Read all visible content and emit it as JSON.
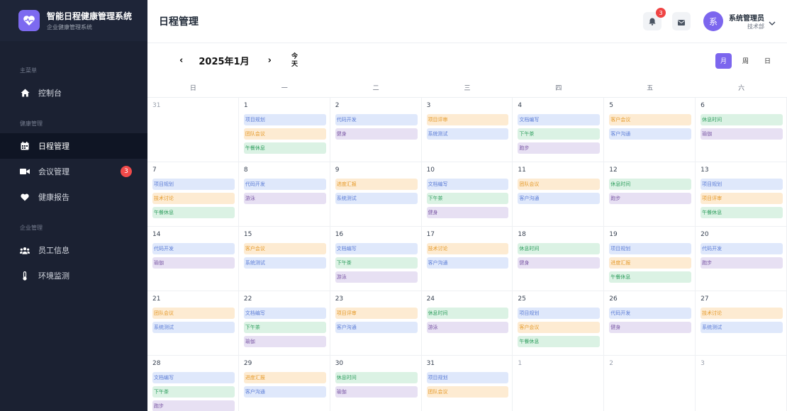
{
  "brand": {
    "title": "智能日程健康管理系统",
    "subtitle": "企业健康管理系统"
  },
  "sidebar": {
    "group_main": "主菜单",
    "group_health": "健康管理",
    "group_enterprise": "企业管理",
    "items": [
      {
        "label": "控制台",
        "icon": "home-icon"
      },
      {
        "label": "日程管理",
        "icon": "calendar-icon"
      },
      {
        "label": "会议管理",
        "icon": "video-icon",
        "badge": "3"
      },
      {
        "label": "健康报告",
        "icon": "heart-icon"
      },
      {
        "label": "员工信息",
        "icon": "users-icon"
      },
      {
        "label": "环境监测",
        "icon": "thermometer-icon"
      }
    ]
  },
  "header": {
    "title": "日程管理",
    "notif_count": "3",
    "avatar_text": "系",
    "user_name": "系统管理员",
    "user_dept": "技术部"
  },
  "toolbar": {
    "prev": "‹",
    "month": "2025年1月",
    "next": "›",
    "today": "今天",
    "view_month": "月",
    "view_week": "周",
    "view_day": "日"
  },
  "colors": {
    "accent": "#7c66ee",
    "sidebar_bg": "#1b2132",
    "badge_red": "#ef4444"
  },
  "weekdays": [
    "日",
    "一",
    "二",
    "三",
    "四",
    "五",
    "六"
  ],
  "weeks": [
    [
      {
        "day": "31",
        "other": true,
        "events": []
      },
      {
        "day": "1",
        "events": [
          {
            "t": "项目规划",
            "c": "blue"
          },
          {
            "t": "团队会议",
            "c": "orange"
          },
          {
            "t": "午餐休息",
            "c": "green"
          }
        ]
      },
      {
        "day": "2",
        "events": [
          {
            "t": "代码开发",
            "c": "blue"
          },
          {
            "t": "健身",
            "c": "purple"
          }
        ]
      },
      {
        "day": "3",
        "events": [
          {
            "t": "项目评审",
            "c": "orange"
          },
          {
            "t": "系统测试",
            "c": "blue"
          }
        ]
      },
      {
        "day": "4",
        "events": [
          {
            "t": "文档编写",
            "c": "blue"
          },
          {
            "t": "下午茶",
            "c": "green"
          },
          {
            "t": "跑步",
            "c": "purple"
          }
        ]
      },
      {
        "day": "5",
        "events": [
          {
            "t": "客户会议",
            "c": "orange"
          },
          {
            "t": "客户沟通",
            "c": "blue"
          }
        ]
      },
      {
        "day": "6",
        "events": [
          {
            "t": "休息时间",
            "c": "green"
          },
          {
            "t": "瑜伽",
            "c": "purple"
          }
        ]
      }
    ],
    [
      {
        "day": "7",
        "events": [
          {
            "t": "项目规划",
            "c": "blue"
          },
          {
            "t": "技术讨论",
            "c": "orange"
          },
          {
            "t": "午餐休息",
            "c": "green"
          }
        ]
      },
      {
        "day": "8",
        "events": [
          {
            "t": "代码开发",
            "c": "blue"
          },
          {
            "t": "游泳",
            "c": "purple"
          }
        ]
      },
      {
        "day": "9",
        "events": [
          {
            "t": "进度汇报",
            "c": "orange"
          },
          {
            "t": "系统测试",
            "c": "blue"
          }
        ]
      },
      {
        "day": "10",
        "events": [
          {
            "t": "文档编写",
            "c": "blue"
          },
          {
            "t": "下午茶",
            "c": "green"
          },
          {
            "t": "健身",
            "c": "purple"
          }
        ]
      },
      {
        "day": "11",
        "events": [
          {
            "t": "团队会议",
            "c": "orange"
          },
          {
            "t": "客户沟通",
            "c": "blue"
          }
        ]
      },
      {
        "day": "12",
        "events": [
          {
            "t": "休息时间",
            "c": "green"
          },
          {
            "t": "跑步",
            "c": "purple"
          }
        ]
      },
      {
        "day": "13",
        "events": [
          {
            "t": "项目规划",
            "c": "blue"
          },
          {
            "t": "项目评审",
            "c": "orange"
          },
          {
            "t": "午餐休息",
            "c": "green"
          }
        ]
      }
    ],
    [
      {
        "day": "14",
        "events": [
          {
            "t": "代码开发",
            "c": "blue"
          },
          {
            "t": "瑜伽",
            "c": "purple"
          }
        ]
      },
      {
        "day": "15",
        "events": [
          {
            "t": "客户会议",
            "c": "orange"
          },
          {
            "t": "系统测试",
            "c": "blue"
          }
        ]
      },
      {
        "day": "16",
        "events": [
          {
            "t": "文档编写",
            "c": "blue"
          },
          {
            "t": "下午茶",
            "c": "green"
          },
          {
            "t": "游泳",
            "c": "purple"
          }
        ]
      },
      {
        "day": "17",
        "events": [
          {
            "t": "技术讨论",
            "c": "orange"
          },
          {
            "t": "客户沟通",
            "c": "blue"
          }
        ]
      },
      {
        "day": "18",
        "events": [
          {
            "t": "休息时间",
            "c": "green"
          },
          {
            "t": "健身",
            "c": "purple"
          }
        ]
      },
      {
        "day": "19",
        "events": [
          {
            "t": "项目规划",
            "c": "blue"
          },
          {
            "t": "进度汇报",
            "c": "orange"
          },
          {
            "t": "午餐休息",
            "c": "green"
          }
        ]
      },
      {
        "day": "20",
        "events": [
          {
            "t": "代码开发",
            "c": "blue"
          },
          {
            "t": "跑步",
            "c": "purple"
          }
        ]
      }
    ],
    [
      {
        "day": "21",
        "events": [
          {
            "t": "团队会议",
            "c": "orange"
          },
          {
            "t": "系统测试",
            "c": "blue"
          }
        ]
      },
      {
        "day": "22",
        "events": [
          {
            "t": "文档编写",
            "c": "blue"
          },
          {
            "t": "下午茶",
            "c": "green"
          },
          {
            "t": "瑜伽",
            "c": "purple"
          }
        ]
      },
      {
        "day": "23",
        "events": [
          {
            "t": "项目评审",
            "c": "orange"
          },
          {
            "t": "客户沟通",
            "c": "blue"
          }
        ]
      },
      {
        "day": "24",
        "events": [
          {
            "t": "休息时间",
            "c": "green"
          },
          {
            "t": "游泳",
            "c": "purple"
          }
        ]
      },
      {
        "day": "25",
        "events": [
          {
            "t": "项目规划",
            "c": "blue"
          },
          {
            "t": "客户会议",
            "c": "orange"
          },
          {
            "t": "午餐休息",
            "c": "green"
          }
        ]
      },
      {
        "day": "26",
        "events": [
          {
            "t": "代码开发",
            "c": "blue"
          },
          {
            "t": "健身",
            "c": "purple"
          }
        ]
      },
      {
        "day": "27",
        "events": [
          {
            "t": "技术讨论",
            "c": "orange"
          },
          {
            "t": "系统测试",
            "c": "blue"
          }
        ]
      }
    ],
    [
      {
        "day": "28",
        "events": [
          {
            "t": "文档编写",
            "c": "blue"
          },
          {
            "t": "下午茶",
            "c": "green"
          },
          {
            "t": "跑步",
            "c": "purple"
          }
        ]
      },
      {
        "day": "29",
        "events": [
          {
            "t": "进度汇报",
            "c": "orange"
          },
          {
            "t": "客户沟通",
            "c": "blue"
          }
        ]
      },
      {
        "day": "30",
        "events": [
          {
            "t": "休息时间",
            "c": "green"
          },
          {
            "t": "瑜伽",
            "c": "purple"
          }
        ]
      },
      {
        "day": "31",
        "events": [
          {
            "t": "项目规划",
            "c": "blue"
          },
          {
            "t": "团队会议",
            "c": "orange"
          }
        ]
      },
      {
        "day": "1",
        "other": true,
        "events": []
      },
      {
        "day": "2",
        "other": true,
        "events": []
      },
      {
        "day": "3",
        "other": true,
        "events": []
      }
    ]
  ]
}
